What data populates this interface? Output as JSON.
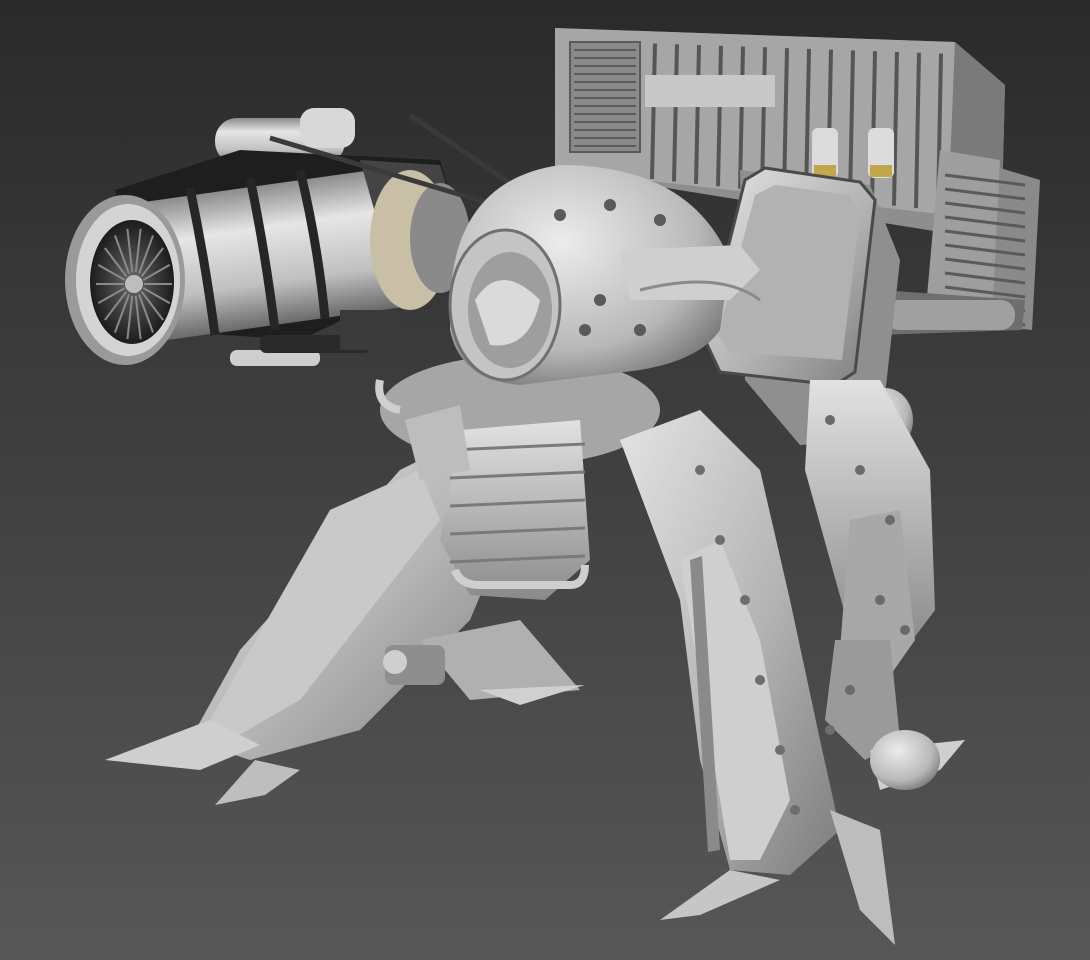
{
  "viewport": {
    "background_top": "#2a2a2a",
    "background_bottom": "#575757",
    "model_base": "#b8b8b8",
    "model_light": "#dcdcdc",
    "model_mid": "#9c9c9c",
    "model_dark": "#5e5e5e",
    "model_black": "#1e1e1e",
    "model_accent": "#c9bfa6",
    "brass": "#c2a64a"
  }
}
